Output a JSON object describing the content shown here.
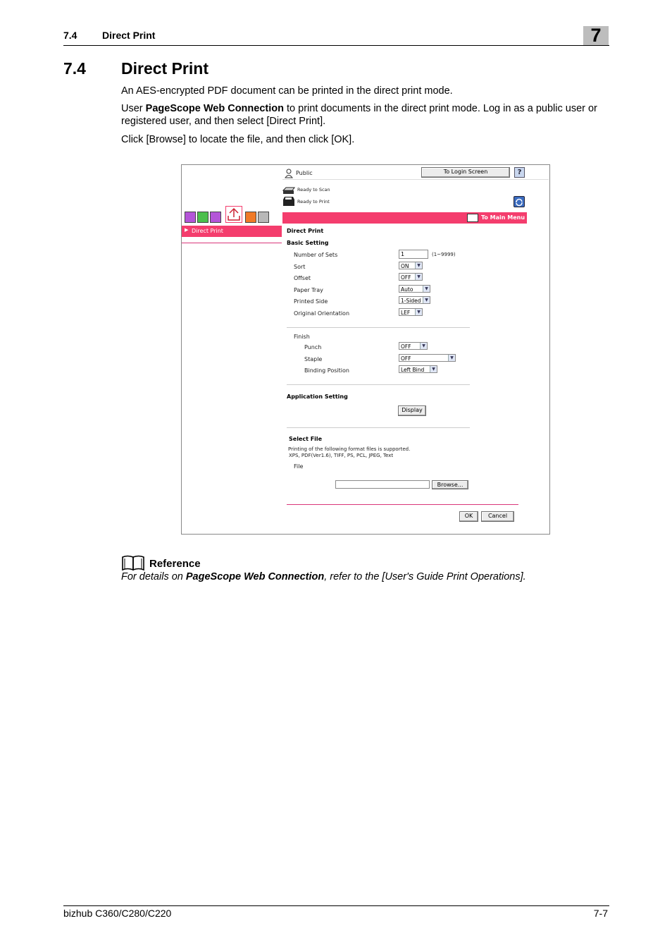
{
  "header": {
    "section_number": "7.4",
    "section_title": "Direct Print",
    "chapter_number": "7"
  },
  "heading": {
    "number": "7.4",
    "title": "Direct Print"
  },
  "body": {
    "p1": "An AES-encrypted PDF document can be printed in the direct print mode.",
    "p2_before": "User ",
    "p2_bold": "PageScope Web Connection",
    "p2_after_line1": " to print documents in the direct print mode. Log in as a public user or",
    "p2_line2": "registered user, and then select [Direct Print].",
    "p3": "Click [Browse] to locate the file, and then click [OK]."
  },
  "screenshot": {
    "user_label": "Public",
    "login_button": "To Login Screen",
    "help_icon_glyph": "?",
    "scanner_status": "Ready to Scan",
    "printer_status": "Ready to Print",
    "main_menu_label": "To Main Menu",
    "sidebar_item": "Direct Print",
    "page_title": "Direct Print",
    "basic_setting": "Basic Setting",
    "fields": {
      "sets_label": "Number of Sets",
      "sets_value": "1",
      "sets_range": "(1~9999)",
      "sort_label": "Sort",
      "sort_value": "ON",
      "offset_label": "Offset",
      "offset_value": "OFF",
      "tray_label": "Paper Tray",
      "tray_value": "Auto",
      "side_label": "Printed Side",
      "side_value": "1-Sided",
      "orient_label": "Original Orientation",
      "orient_value": "LEF"
    },
    "finish": {
      "label": "Finish",
      "punch_label": "Punch",
      "punch_value": "OFF",
      "staple_label": "Staple",
      "staple_value": "OFF",
      "binding_label": "Binding Position",
      "binding_value": "Left Bind"
    },
    "application_setting": "Application Setting",
    "display_button": "Display",
    "select_file": "Select File",
    "supported_line1": "Printing of the following format files is supported.",
    "supported_line2": "XPS, PDF(Ver1.6), TIFF, PS, PCL, JPEG, Text",
    "file_label": "File",
    "browse_button": "Browse...",
    "ok_button": "OK",
    "cancel_button": "Cancel",
    "colors": {
      "nav_bar": "#f43d6d",
      "pink_line": "#d9367a"
    }
  },
  "reference": {
    "title": "Reference",
    "text_before": "For details on ",
    "text_bold": "PageScope Web Connection",
    "text_after": ", refer to the [User's Guide Print Operations]."
  },
  "footer": {
    "product": "bizhub C360/C280/C220",
    "page": "7-7"
  }
}
